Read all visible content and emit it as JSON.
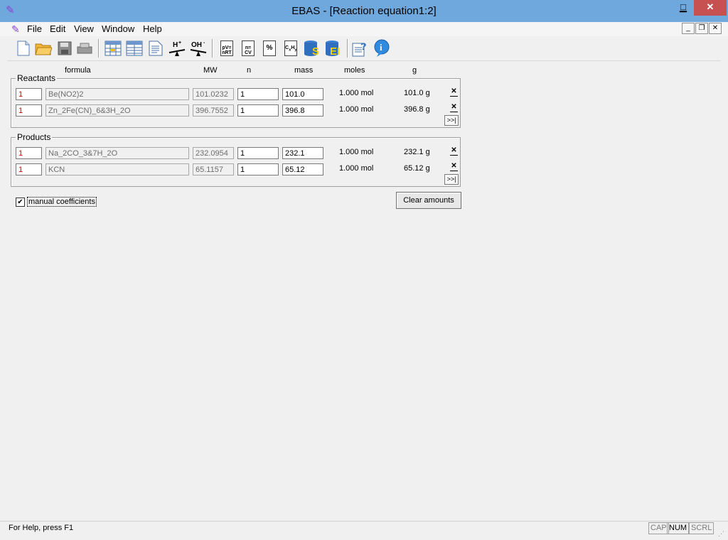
{
  "window": {
    "title": "EBAS - [Reaction equation1:2]",
    "minimize": "▁",
    "maximize": "□",
    "close": "✕"
  },
  "menu": {
    "items": [
      "File",
      "Edit",
      "View",
      "Window",
      "Help"
    ]
  },
  "mdi": {
    "minimize": "_",
    "restore": "❐",
    "close": "✕"
  },
  "toolbar": {
    "buttons": [
      {
        "icon": "new-document-icon"
      },
      {
        "icon": "open-folder-icon"
      },
      {
        "icon": "save-disk-icon"
      },
      {
        "icon": "print-icon"
      },
      {
        "icon": "table-view-icon"
      },
      {
        "icon": "table-list-icon"
      },
      {
        "icon": "document-view-icon"
      },
      {
        "icon": "h-plus-balance-icon",
        "text": "H+"
      },
      {
        "icon": "oh-minus-balance-icon",
        "text": "OH-"
      },
      {
        "icon": "calculator-pv-nrt-icon",
        "text": "pV=nRT"
      },
      {
        "icon": "calculator-ncv-icon",
        "text": "n=CV"
      },
      {
        "icon": "calculator-percent-icon",
        "text": "%"
      },
      {
        "icon": "calculator-cxhy-icon",
        "text": "CxHy"
      },
      {
        "icon": "database-s-icon",
        "text": "S"
      },
      {
        "icon": "database-ei-icon",
        "text": "EI"
      },
      {
        "icon": "help-context-icon"
      },
      {
        "icon": "info-icon",
        "text": "i"
      }
    ]
  },
  "headers": {
    "formula": "formula",
    "mw": "MW",
    "n": "n",
    "mass": "mass",
    "moles": "moles",
    "g": "g"
  },
  "reactants": {
    "label": "Reactants",
    "rows": [
      {
        "coef": "1",
        "formula": "Be(NO2)2",
        "mw": "101.0232",
        "n": "1",
        "mass": "101.0",
        "moles": "1.000 mol",
        "g": "101.0 g"
      },
      {
        "coef": "1",
        "formula": "Zn_2Fe(CN)_6&3H_2O",
        "mw": "396.7552",
        "n": "1",
        "mass": "396.8",
        "moles": "1.000 mol",
        "g": "396.8 g"
      }
    ]
  },
  "products": {
    "label": "Products",
    "rows": [
      {
        "coef": "1",
        "formula": "Na_2CO_3&7H_2O",
        "mw": "232.0954",
        "n": "1",
        "mass": "232.1",
        "moles": "1.000 mol",
        "g": "232.1 g"
      },
      {
        "coef": "1",
        "formula": "KCN",
        "mw": "65.1157",
        "n": "1",
        "mass": "65.12",
        "moles": "1.000 mol",
        "g": "65.12 g"
      }
    ]
  },
  "remove_label": "✕",
  "more_label": ">>|",
  "manual_coefficients": {
    "label": "manual coefficients",
    "checked": true,
    "mark": "✔"
  },
  "clear_amounts": "Clear amounts",
  "status": {
    "text": "For Help, press F1",
    "indicators": [
      "CAP",
      "NUM",
      "SCRL"
    ]
  }
}
